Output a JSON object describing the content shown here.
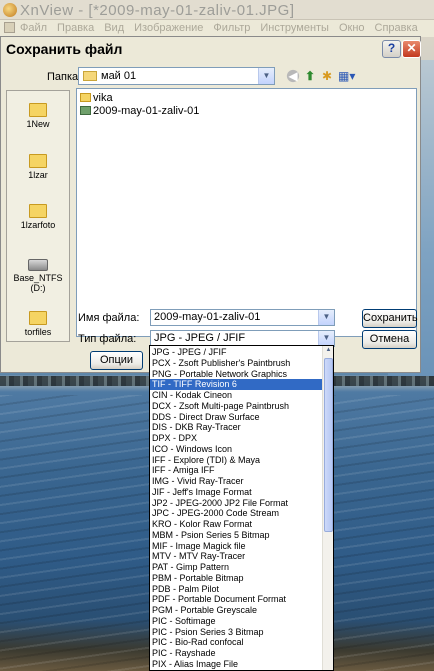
{
  "app": {
    "title": "XnView - [*2009-may-01-zaliv-01.JPG]",
    "menu": [
      "Файл",
      "Правка",
      "Вид",
      "Изображение",
      "Фильтр",
      "Инструменты",
      "Окно",
      "Справка"
    ]
  },
  "dialog": {
    "title": "Сохранить файл",
    "help_icon": "?",
    "close_icon": "✕",
    "folder_label": "Папка:",
    "folder_value": "май 01",
    "nav_icons": [
      "back-icon",
      "up-folder-icon",
      "new-folder-icon",
      "views-menu-icon"
    ],
    "places": [
      {
        "label": "1New",
        "icon": "folder-icon"
      },
      {
        "label": "1lzar",
        "icon": "folder-icon"
      },
      {
        "label": "1lzarfoto",
        "icon": "folder-icon"
      },
      {
        "label": "Base_NTFS (D:)",
        "icon": "drive-icon"
      },
      {
        "label": "torfiles",
        "icon": "folder-icon"
      }
    ],
    "files": [
      {
        "name": "vika",
        "icon": "folder-icon"
      },
      {
        "name": "2009-may-01-zaliv-01",
        "icon": "jpg-file-icon"
      }
    ],
    "filename_label": "Имя файла:",
    "filename_value": "2009-may-01-zaliv-01",
    "filetype_label": "Тип файла:",
    "filetype_value": "JPG - JPEG / JFIF",
    "save_label": "Сохранить",
    "cancel_label": "Отмена",
    "options_label": "Опции"
  },
  "type_list": {
    "selected_index": 3,
    "items": [
      "JPG - JPEG / JFIF",
      "PCX - Zsoft Publisher's Paintbrush",
      "PNG - Portable Network Graphics",
      "TIF - TIFF Revision 6",
      "CIN - Kodak Cineon",
      "DCX - Zsoft Multi-page Paintbrush",
      "DDS - Direct Draw Surface",
      "DIS - DKB Ray-Tracer",
      "DPX - DPX",
      "ICO - Windows Icon",
      "IFF - Explore (TDI) & Maya",
      "IFF - Amiga IFF",
      "IMG - Vivid Ray-Tracer",
      "JIF - Jeff's Image Format",
      "JP2 - JPEG-2000 JP2 File Format",
      "JPC - JPEG-2000 Code Stream",
      "KRO - Kolor Raw Format",
      "MBM - Psion Series 5 Bitmap",
      "MIF - Image Magick file",
      "MTV - MTV Ray-Tracer",
      "PAT - Gimp Pattern",
      "PBM - Portable Bitmap",
      "PDB - Palm Pilot",
      "PDF - Portable Document Format",
      "PGM - Portable Greyscale",
      "PIC - Softimage",
      "PIC - Psion Series 3 Bitmap",
      "PIC - Bio-Rad confocal",
      "PIC - Rayshade",
      "PIX - Alias Image File"
    ]
  }
}
